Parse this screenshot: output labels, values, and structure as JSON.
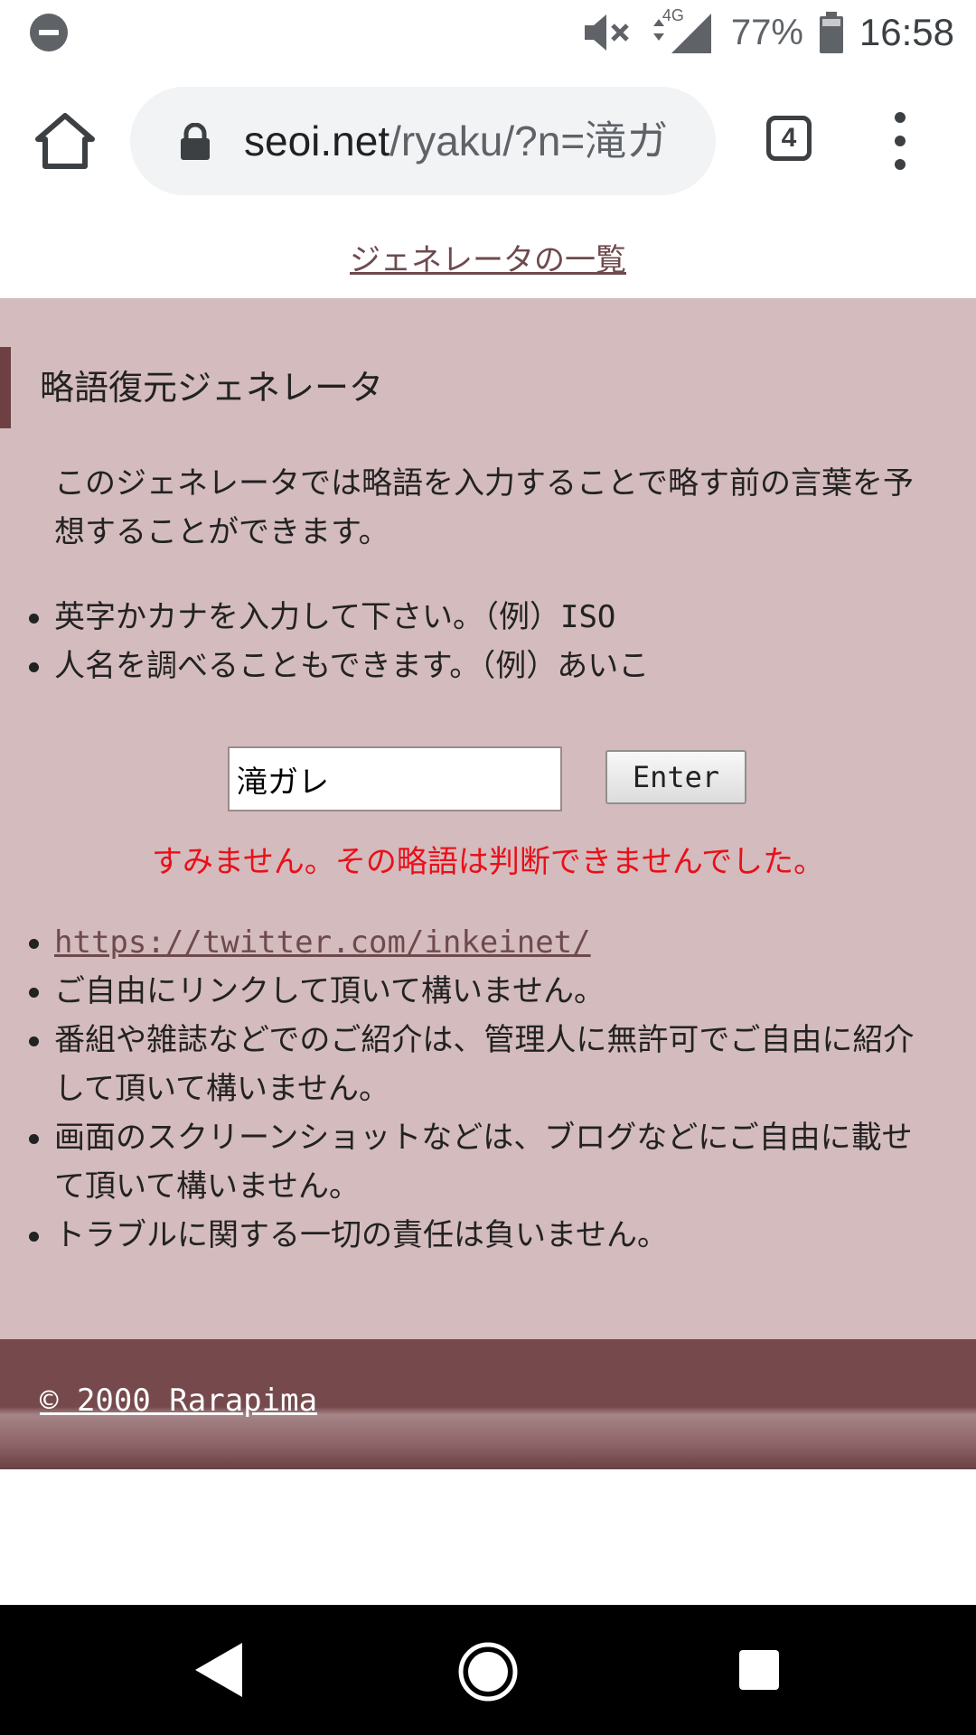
{
  "status_bar": {
    "battery_text": "77%",
    "time": "16:58",
    "network_label": "4G"
  },
  "browser": {
    "url_domain": "seoi.net",
    "url_path": "/ryaku/?n=滝ガ",
    "tab_count": "4"
  },
  "page": {
    "top_link": "ジェネレータの一覧",
    "heading": "略語復元ジェネレータ",
    "description": "このジェネレータでは略語を入力することで略す前の言葉を予想することができます。",
    "hints": [
      {
        "text": "英字かカナを入力して下さい。（例）",
        "example": "ISO"
      },
      {
        "text": "人名を調べることもできます。（例）あいこ",
        "example": ""
      }
    ],
    "input_value": "滝ガレ",
    "enter_label": "Enter",
    "error_message": "すみません。その略語は判断できませんでした。",
    "twitter_url": "https://twitter.com/inkeinet/",
    "notes": [
      "ご自由にリンクして頂いて構いません。",
      "番組や雑誌などでのご紹介は、管理人に無許可でご自由に紹介して頂いて構いません。",
      "画面のスクリーンショットなどは、ブログなどにご自由に載せて頂いて構いません。",
      "トラブルに関する一切の責任は負いません。"
    ],
    "copyright": "© 2000 Rarapima"
  },
  "colors": {
    "content_bg": "#d4bbbd",
    "accent": "#6f4043",
    "error": "#e8101a",
    "link": "#6e4a4d"
  }
}
